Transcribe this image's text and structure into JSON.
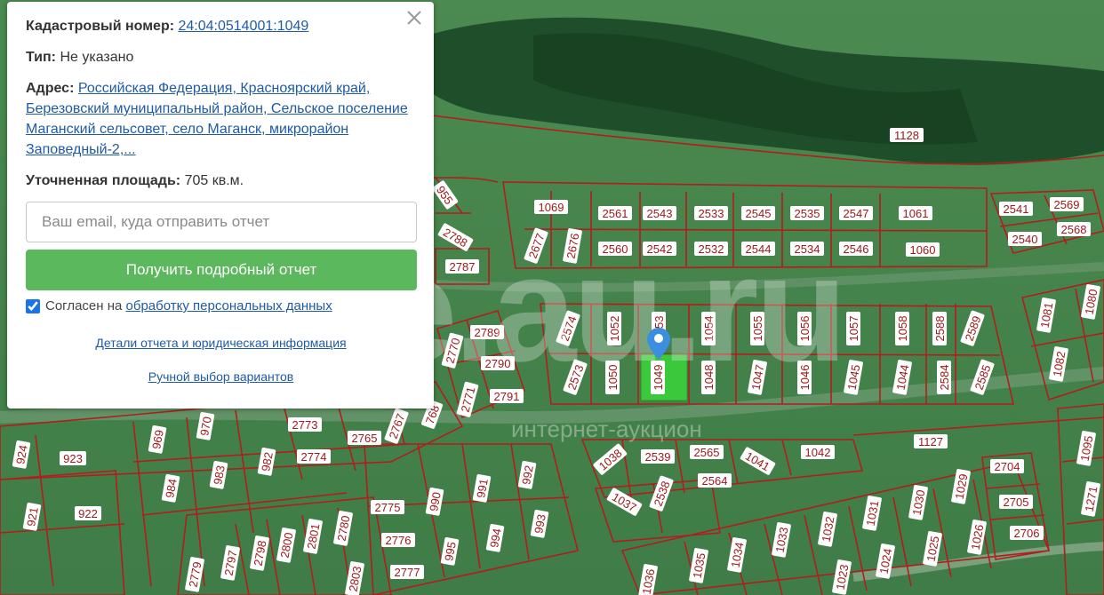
{
  "panel": {
    "cadastral_label": "Кадастровый номер:",
    "cadastral_value": "24:04:0514001:1049",
    "type_label": "Тип:",
    "type_value": "Не указано",
    "address_label": "Адрес:",
    "address_value": "Российская Федерация, Красноярский край, Березовский муниципальный район, Сельское поселение Маганский сельсовет, село Маганск, микрорайон Заповедный-2,...",
    "area_label": "Уточненная площадь:",
    "area_value": "705 кв.м.",
    "email_placeholder": "Ваш email, куда отправить отчет",
    "report_button": "Получить подробный отчет",
    "consent_prefix": "Согласен на",
    "consent_link": "обработку персональных данных",
    "consent_checked": true,
    "details_link": "Детали отчета и юридическая информация",
    "manual_link": "Ручной выбор вариантов"
  },
  "map": {
    "watermark_main": "e.au.ru",
    "watermark_sub": "интернет-аукцион",
    "selected_parcel": "1049",
    "parcel_labels": [
      "1128",
      "955",
      "2788",
      "2787",
      "1069",
      "2561",
      "2543",
      "2533",
      "2545",
      "2535",
      "2547",
      "1061",
      "2541",
      "2569",
      "2677",
      "2676",
      "2560",
      "2542",
      "2532",
      "2544",
      "2534",
      "2546",
      "1060",
      "2540",
      "2568",
      "2789",
      "2770",
      "2790",
      "2771",
      "2791",
      "2574",
      "1052",
      "1053",
      "1054",
      "1055",
      "1056",
      "1057",
      "1058",
      "2588",
      "2589",
      "1081",
      "1080",
      "2573",
      "1050",
      "1048",
      "1047",
      "1046",
      "1045",
      "1044",
      "2584",
      "2585",
      "1082",
      "924",
      "923",
      "969",
      "970",
      "2773",
      "2765",
      "2767",
      "768",
      "1127",
      "1095",
      "921",
      "922",
      "984",
      "983",
      "982",
      "2774",
      "992",
      "991",
      "1038",
      "2539",
      "2565",
      "1041",
      "1042",
      "2704",
      "1029",
      "2775",
      "990",
      "993",
      "1037",
      "2538",
      "2564",
      "1030",
      "2705",
      "1271",
      "2779",
      "2797",
      "2798",
      "2800",
      "2801",
      "2780",
      "2776",
      "995",
      "994",
      "2706",
      "1026",
      "1025",
      "1024",
      "1031",
      "1032",
      "1033",
      "1034",
      "1035",
      "1036",
      "1023",
      "2777",
      "2803"
    ],
    "colors": {
      "parcel_outline": "#b01e1e",
      "selected_fill": "#3cc83c",
      "pin": "#3b8fe0"
    }
  }
}
